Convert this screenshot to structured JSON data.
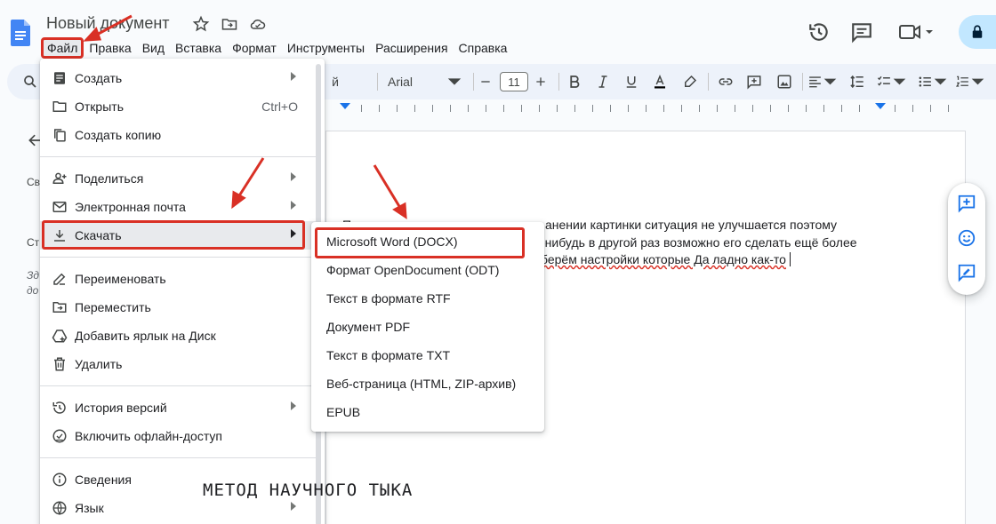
{
  "document": {
    "title": "Новый документ"
  },
  "menubar": {
    "items": [
      {
        "label": "Файл"
      },
      {
        "label": "Правка"
      },
      {
        "label": "Вид"
      },
      {
        "label": "Вставка"
      },
      {
        "label": "Формат"
      },
      {
        "label": "Инструменты"
      },
      {
        "label": "Расширения"
      },
      {
        "label": "Справка"
      }
    ]
  },
  "toolbar": {
    "font_name": "Arial",
    "font_size": "11",
    "style_fragment": "й"
  },
  "page": {
    "lines": [
      "П",
      "анении картинки ситуация не улучшается поэтому",
      "-нибудь в другой раз возможно его сделать ещё более",
      "берём настройки которые Да ладно как-то"
    ]
  },
  "outline": {
    "frag1": "Св",
    "frag2": "Ст",
    "frag3": "Зд",
    "frag4": "до"
  },
  "file_menu": {
    "items": [
      {
        "label": "Создать",
        "icon": "new-doc-icon",
        "submenu": true
      },
      {
        "label": "Открыть",
        "icon": "folder-icon",
        "shortcut": "Ctrl+O"
      },
      {
        "label": "Создать копию",
        "icon": "copy-icon"
      },
      {
        "label": "Поделиться",
        "icon": "person-add-icon",
        "submenu": true
      },
      {
        "label": "Электронная почта",
        "icon": "email-icon",
        "submenu": true
      },
      {
        "label": "Скачать",
        "icon": "download-icon",
        "submenu": true
      },
      {
        "label": "Переименовать",
        "icon": "rename-icon"
      },
      {
        "label": "Переместить",
        "icon": "move-folder-icon"
      },
      {
        "label": "Добавить ярлык на Диск",
        "icon": "drive-shortcut-icon"
      },
      {
        "label": "Удалить",
        "icon": "trash-icon"
      },
      {
        "label": "История версий",
        "icon": "history-icon",
        "submenu": true
      },
      {
        "label": "Включить офлайн-доступ",
        "icon": "offline-icon"
      },
      {
        "label": "Сведения",
        "icon": "info-icon"
      },
      {
        "label": "Язык",
        "icon": "globe-icon",
        "submenu": true
      }
    ]
  },
  "download_menu": {
    "items": [
      {
        "label": "Microsoft Word (DOCX)"
      },
      {
        "label": "Формат OpenDocument (ODT)"
      },
      {
        "label": "Текст в формате RTF"
      },
      {
        "label": "Документ PDF"
      },
      {
        "label": "Текст в формате TXT"
      },
      {
        "label": "Веб-страница (HTML, ZIP-архив)"
      },
      {
        "label": "EPUB"
      }
    ]
  },
  "caption": "МЕТОД НАУЧНОГО ТЫКА",
  "colors": {
    "accent_red": "#d93025",
    "share_button": "#c2e7ff",
    "toolbar_bg": "#edf2fa",
    "docs_blue": "#4285f4"
  }
}
